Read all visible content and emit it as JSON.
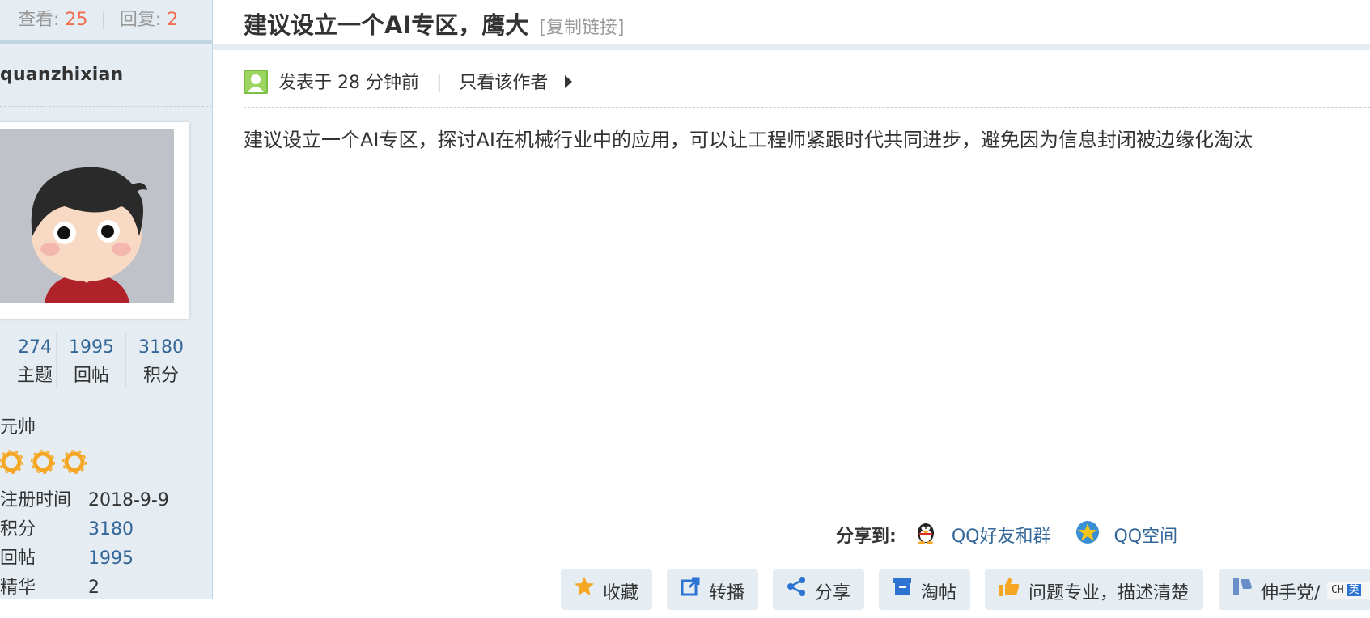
{
  "sidebar": {
    "views_label": "查看:",
    "views": "25",
    "replies_label": "回复:",
    "replies": "2",
    "author": "quanzhixian",
    "stats": [
      {
        "value": "274",
        "label": "主题"
      },
      {
        "value": "1995",
        "label": "回帖"
      },
      {
        "value": "3180",
        "label": "积分"
      }
    ],
    "rank": "元帅",
    "star_count": 3,
    "info": [
      {
        "key": "注册时间",
        "value": "2018-9-9",
        "link": false
      },
      {
        "key": "积分",
        "value": "3180",
        "link": true
      },
      {
        "key": "回帖",
        "value": "1995",
        "link": true
      },
      {
        "key": "精华",
        "value": "2",
        "link": false
      }
    ]
  },
  "post": {
    "title": "建议设立一个AI专区，鹰大",
    "copy_link": "[复制链接]",
    "posted": "发表于 28 分钟前",
    "only_author": "只看该作者",
    "body": "建议设立一个AI专区，探讨AI在机械行业中的应用，可以让工程师紧跟时代共同进步，避免因为信息封闭被边缘化淘汰"
  },
  "share": {
    "label": "分享到:",
    "qq_friends": "QQ好友和群",
    "qzone": "QQ空间"
  },
  "actions": {
    "favorite": "收藏",
    "forward": "转播",
    "share": "分享",
    "tao": "淘帖",
    "vote": "问题专业，描述清楚",
    "hand": "伸手党/"
  },
  "ime": {
    "mode": "CH",
    "icon": "英"
  },
  "colors": {
    "accent": "#336699",
    "count": "#f26c4f",
    "sidebar_bg": "#e5edf2",
    "star": "#f5a623"
  }
}
